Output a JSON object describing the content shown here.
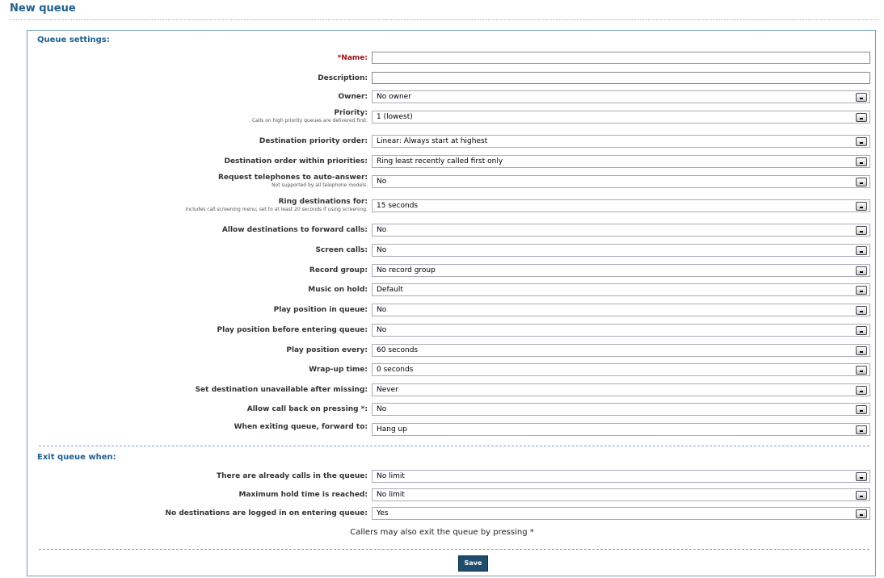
{
  "page": {
    "title": "New queue"
  },
  "queue_settings": {
    "heading": "Queue settings:",
    "name": {
      "label": "*Name:",
      "value": ""
    },
    "description": {
      "label": "Description:",
      "value": ""
    },
    "owner": {
      "label": "Owner:",
      "value": "No owner"
    },
    "priority": {
      "label": "Priority:",
      "sub": "Calls on high priority queues are delivered first.",
      "value": "1 (lowest)"
    },
    "destination_priority_order": {
      "label": "Destination priority order:",
      "value": "Linear: Always start at highest"
    },
    "destination_order_within": {
      "label": "Destination order within priorities:",
      "value": "Ring least recently called first only"
    },
    "auto_answer": {
      "label": "Request telephones to auto-answer:",
      "sub": "Not supported by all telephone models.",
      "value": "No"
    },
    "ring_for": {
      "label": "Ring destinations for:",
      "sub": "Includes call screening menu; set to at least 20 seconds if using screening.",
      "value": "15 seconds"
    },
    "allow_forward": {
      "label": "Allow destinations to forward calls:",
      "value": "No"
    },
    "screen_calls": {
      "label": "Screen calls:",
      "value": "No"
    },
    "record_group": {
      "label": "Record group:",
      "value": "No record group"
    },
    "music_on_hold": {
      "label": "Music on hold:",
      "value": "Default"
    },
    "play_position": {
      "label": "Play position in queue:",
      "value": "No"
    },
    "play_position_before": {
      "label": "Play position before entering queue:",
      "value": "No"
    },
    "play_position_every": {
      "label": "Play position every:",
      "value": "60 seconds"
    },
    "wrap_up": {
      "label": "Wrap-up time:",
      "value": "0 seconds"
    },
    "unavailable_after": {
      "label": "Set destination unavailable after missing:",
      "value": "Never"
    },
    "call_back": {
      "label": "Allow call back on pressing *:",
      "value": "No"
    },
    "exit_forward": {
      "label": "When exiting queue, forward to:",
      "value": "Hang up"
    }
  },
  "exit_queue": {
    "heading": "Exit queue when:",
    "calls_in_queue": {
      "label": "There are already calls in the queue:",
      "value": "No limit"
    },
    "max_hold": {
      "label": "Maximum hold time is reached:",
      "value": "No limit"
    },
    "no_destinations": {
      "label": "No destinations are logged in on entering queue:",
      "value": "Yes"
    },
    "note": "Callers may also exit the queue by pressing *"
  },
  "actions": {
    "save": "Save"
  }
}
